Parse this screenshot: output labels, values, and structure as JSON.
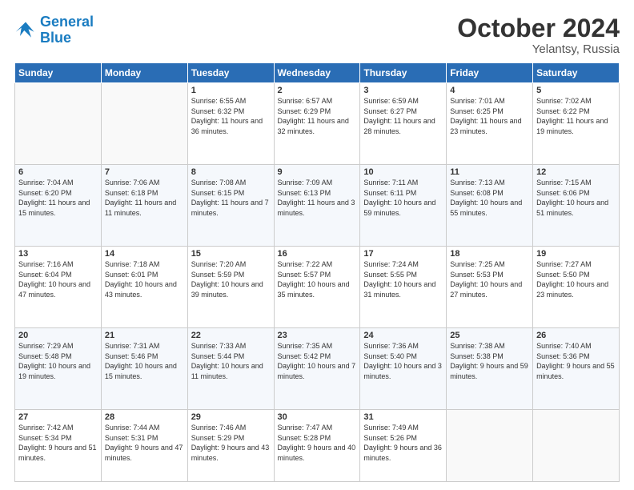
{
  "logo": {
    "text_general": "General",
    "text_blue": "Blue"
  },
  "header": {
    "month": "October 2024",
    "location": "Yelantsy, Russia"
  },
  "weekdays": [
    "Sunday",
    "Monday",
    "Tuesday",
    "Wednesday",
    "Thursday",
    "Friday",
    "Saturday"
  ],
  "weeks": [
    [
      {
        "day": "",
        "info": ""
      },
      {
        "day": "",
        "info": ""
      },
      {
        "day": "1",
        "info": "Sunrise: 6:55 AM\nSunset: 6:32 PM\nDaylight: 11 hours and 36 minutes."
      },
      {
        "day": "2",
        "info": "Sunrise: 6:57 AM\nSunset: 6:29 PM\nDaylight: 11 hours and 32 minutes."
      },
      {
        "day": "3",
        "info": "Sunrise: 6:59 AM\nSunset: 6:27 PM\nDaylight: 11 hours and 28 minutes."
      },
      {
        "day": "4",
        "info": "Sunrise: 7:01 AM\nSunset: 6:25 PM\nDaylight: 11 hours and 23 minutes."
      },
      {
        "day": "5",
        "info": "Sunrise: 7:02 AM\nSunset: 6:22 PM\nDaylight: 11 hours and 19 minutes."
      }
    ],
    [
      {
        "day": "6",
        "info": "Sunrise: 7:04 AM\nSunset: 6:20 PM\nDaylight: 11 hours and 15 minutes."
      },
      {
        "day": "7",
        "info": "Sunrise: 7:06 AM\nSunset: 6:18 PM\nDaylight: 11 hours and 11 minutes."
      },
      {
        "day": "8",
        "info": "Sunrise: 7:08 AM\nSunset: 6:15 PM\nDaylight: 11 hours and 7 minutes."
      },
      {
        "day": "9",
        "info": "Sunrise: 7:09 AM\nSunset: 6:13 PM\nDaylight: 11 hours and 3 minutes."
      },
      {
        "day": "10",
        "info": "Sunrise: 7:11 AM\nSunset: 6:11 PM\nDaylight: 10 hours and 59 minutes."
      },
      {
        "day": "11",
        "info": "Sunrise: 7:13 AM\nSunset: 6:08 PM\nDaylight: 10 hours and 55 minutes."
      },
      {
        "day": "12",
        "info": "Sunrise: 7:15 AM\nSunset: 6:06 PM\nDaylight: 10 hours and 51 minutes."
      }
    ],
    [
      {
        "day": "13",
        "info": "Sunrise: 7:16 AM\nSunset: 6:04 PM\nDaylight: 10 hours and 47 minutes."
      },
      {
        "day": "14",
        "info": "Sunrise: 7:18 AM\nSunset: 6:01 PM\nDaylight: 10 hours and 43 minutes."
      },
      {
        "day": "15",
        "info": "Sunrise: 7:20 AM\nSunset: 5:59 PM\nDaylight: 10 hours and 39 minutes."
      },
      {
        "day": "16",
        "info": "Sunrise: 7:22 AM\nSunset: 5:57 PM\nDaylight: 10 hours and 35 minutes."
      },
      {
        "day": "17",
        "info": "Sunrise: 7:24 AM\nSunset: 5:55 PM\nDaylight: 10 hours and 31 minutes."
      },
      {
        "day": "18",
        "info": "Sunrise: 7:25 AM\nSunset: 5:53 PM\nDaylight: 10 hours and 27 minutes."
      },
      {
        "day": "19",
        "info": "Sunrise: 7:27 AM\nSunset: 5:50 PM\nDaylight: 10 hours and 23 minutes."
      }
    ],
    [
      {
        "day": "20",
        "info": "Sunrise: 7:29 AM\nSunset: 5:48 PM\nDaylight: 10 hours and 19 minutes."
      },
      {
        "day": "21",
        "info": "Sunrise: 7:31 AM\nSunset: 5:46 PM\nDaylight: 10 hours and 15 minutes."
      },
      {
        "day": "22",
        "info": "Sunrise: 7:33 AM\nSunset: 5:44 PM\nDaylight: 10 hours and 11 minutes."
      },
      {
        "day": "23",
        "info": "Sunrise: 7:35 AM\nSunset: 5:42 PM\nDaylight: 10 hours and 7 minutes."
      },
      {
        "day": "24",
        "info": "Sunrise: 7:36 AM\nSunset: 5:40 PM\nDaylight: 10 hours and 3 minutes."
      },
      {
        "day": "25",
        "info": "Sunrise: 7:38 AM\nSunset: 5:38 PM\nDaylight: 9 hours and 59 minutes."
      },
      {
        "day": "26",
        "info": "Sunrise: 7:40 AM\nSunset: 5:36 PM\nDaylight: 9 hours and 55 minutes."
      }
    ],
    [
      {
        "day": "27",
        "info": "Sunrise: 7:42 AM\nSunset: 5:34 PM\nDaylight: 9 hours and 51 minutes."
      },
      {
        "day": "28",
        "info": "Sunrise: 7:44 AM\nSunset: 5:31 PM\nDaylight: 9 hours and 47 minutes."
      },
      {
        "day": "29",
        "info": "Sunrise: 7:46 AM\nSunset: 5:29 PM\nDaylight: 9 hours and 43 minutes."
      },
      {
        "day": "30",
        "info": "Sunrise: 7:47 AM\nSunset: 5:28 PM\nDaylight: 9 hours and 40 minutes."
      },
      {
        "day": "31",
        "info": "Sunrise: 7:49 AM\nSunset: 5:26 PM\nDaylight: 9 hours and 36 minutes."
      },
      {
        "day": "",
        "info": ""
      },
      {
        "day": "",
        "info": ""
      }
    ]
  ]
}
